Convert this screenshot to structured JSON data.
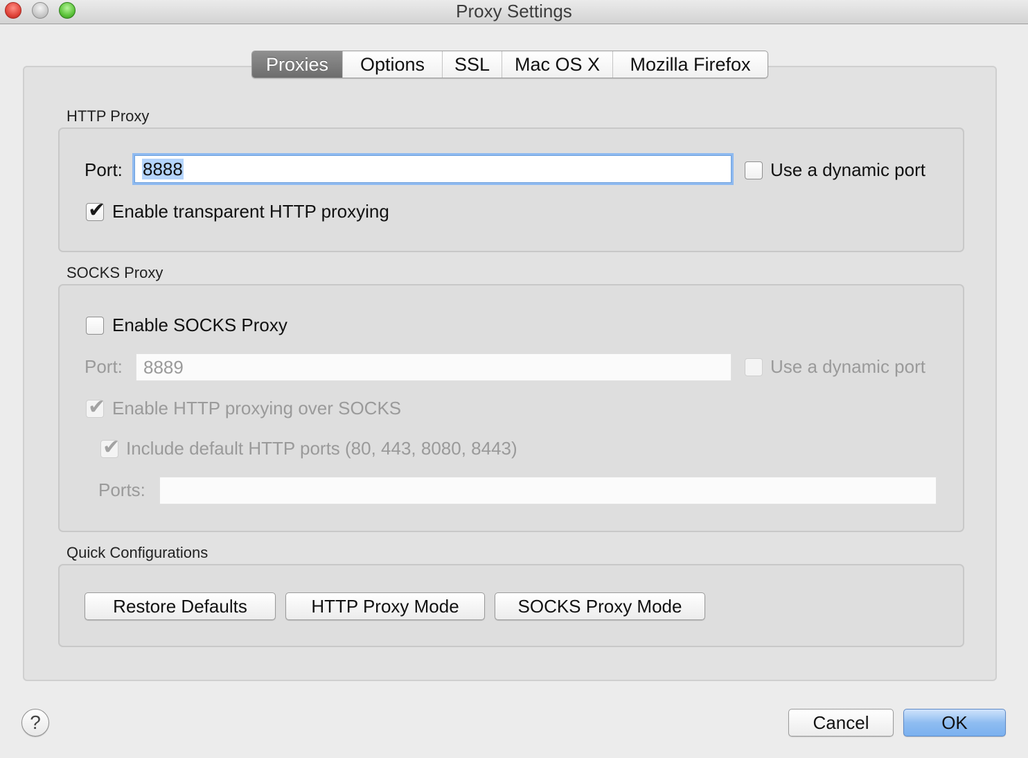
{
  "window": {
    "title": "Proxy Settings"
  },
  "tabs": [
    {
      "label": "Proxies",
      "active": true
    },
    {
      "label": "Options",
      "active": false
    },
    {
      "label": "SSL",
      "active": false
    },
    {
      "label": "Mac OS X",
      "active": false
    },
    {
      "label": "Mozilla Firefox",
      "active": false
    }
  ],
  "http_proxy": {
    "section_label": "HTTP Proxy",
    "port_label": "Port:",
    "port_value": "8888",
    "dynamic_port_label": "Use a dynamic port",
    "dynamic_port_checked": false,
    "transparent_label": "Enable transparent HTTP proxying",
    "transparent_checked": true
  },
  "socks_proxy": {
    "section_label": "SOCKS Proxy",
    "enable_label": "Enable SOCKS Proxy",
    "enable_checked": false,
    "port_label": "Port:",
    "port_value": "8889",
    "dynamic_port_label": "Use a dynamic port",
    "http_over_socks_label": "Enable HTTP proxying over SOCKS",
    "http_over_socks_checked": true,
    "include_default_label": "Include default HTTP ports (80, 443, 8080, 8443)",
    "include_default_checked": true,
    "ports_label": "Ports:",
    "ports_value": ""
  },
  "quick_config": {
    "section_label": "Quick Configurations",
    "restore_defaults": "Restore Defaults",
    "http_mode": "HTTP Proxy Mode",
    "socks_mode": "SOCKS Proxy Mode"
  },
  "footer": {
    "help_symbol": "?",
    "cancel": "Cancel",
    "ok": "OK"
  }
}
